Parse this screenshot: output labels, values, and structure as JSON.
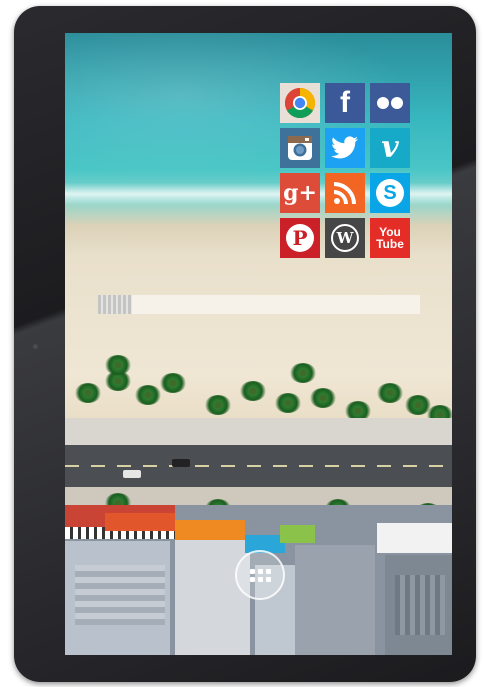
{
  "device": {
    "type": "tablet"
  },
  "search": {
    "placeholder": ""
  },
  "apps": [
    {
      "id": "chrome",
      "label": "",
      "icon": "chrome-icon",
      "color": "#d93025"
    },
    {
      "id": "facebook",
      "label": "f",
      "icon": "facebook-icon",
      "color": "#3b5998"
    },
    {
      "id": "flickr",
      "label": "",
      "icon": "flickr-icon",
      "color": "#3d5a98"
    },
    {
      "id": "instagram",
      "label": "",
      "icon": "instagram-icon",
      "color": "#3f729b"
    },
    {
      "id": "twitter",
      "label": "",
      "icon": "twitter-icon",
      "color": "#1da1f2"
    },
    {
      "id": "vimeo",
      "label": "v",
      "icon": "vimeo-icon",
      "color": "#17a9c8"
    },
    {
      "id": "google-plus",
      "label": "g+",
      "icon": "google-plus-icon",
      "color": "#dd4b39"
    },
    {
      "id": "rss",
      "label": "",
      "icon": "rss-icon",
      "color": "#f26522"
    },
    {
      "id": "skype",
      "label": "S",
      "icon": "skype-icon",
      "color": "#0aa5e6"
    },
    {
      "id": "pinterest",
      "label": "P",
      "icon": "pinterest-icon",
      "color": "#cb2027"
    },
    {
      "id": "wordpress",
      "label": "W",
      "icon": "wordpress-icon",
      "color": "#464646"
    },
    {
      "id": "youtube",
      "label": "You Tube",
      "icon": "youtube-icon",
      "color": "#e52d27"
    }
  ],
  "dock": {
    "launcher_icon": "app-drawer-icon"
  }
}
